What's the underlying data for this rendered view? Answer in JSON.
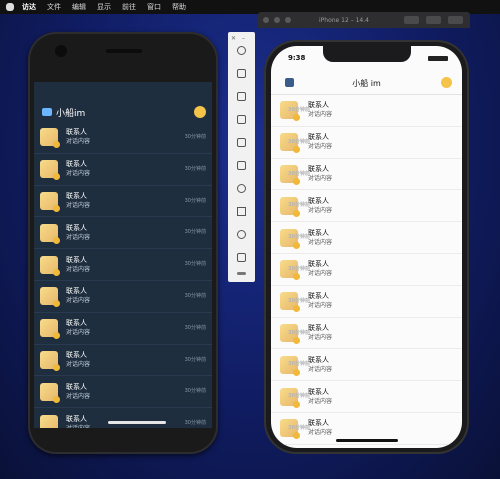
{
  "menubar": {
    "items": [
      "访达",
      "文件",
      "编辑",
      "显示",
      "前往",
      "窗口",
      "帮助"
    ]
  },
  "simulator": {
    "title": "iPhone 12 – 14.4"
  },
  "android": {
    "app_title": "小船im",
    "rows": [
      {
        "name": "联系人",
        "msg": "对话内容",
        "time": "30分钟前"
      },
      {
        "name": "联系人",
        "msg": "对话内容",
        "time": "30分钟前"
      },
      {
        "name": "联系人",
        "msg": "对话内容",
        "time": "30分钟前"
      },
      {
        "name": "联系人",
        "msg": "对话内容",
        "time": "30分钟前"
      },
      {
        "name": "联系人",
        "msg": "对话内容",
        "time": "30分钟前"
      },
      {
        "name": "联系人",
        "msg": "对话内容",
        "time": "30分钟前"
      },
      {
        "name": "联系人",
        "msg": "对话内容",
        "time": "30分钟前"
      },
      {
        "name": "联系人",
        "msg": "对话内容",
        "time": "30分钟前"
      },
      {
        "name": "联系人",
        "msg": "对话内容",
        "time": "30分钟前"
      },
      {
        "name": "联系人",
        "msg": "对话内容",
        "time": "30分钟前"
      }
    ]
  },
  "iphone": {
    "status_time": "9:38",
    "app_title": "小船 im",
    "rows": [
      {
        "name": "联系人",
        "msg": "对话内容",
        "time": "30分钟前"
      },
      {
        "name": "联系人",
        "msg": "对话内容",
        "time": "30分钟前"
      },
      {
        "name": "联系人",
        "msg": "对话内容",
        "time": "30分钟前"
      },
      {
        "name": "联系人",
        "msg": "对话内容",
        "time": "30分钟前"
      },
      {
        "name": "联系人",
        "msg": "对话内容",
        "time": "30分钟前"
      },
      {
        "name": "联系人",
        "msg": "对话内容",
        "time": "30分钟前"
      },
      {
        "name": "联系人",
        "msg": "对话内容",
        "time": "30分钟前"
      },
      {
        "name": "联系人",
        "msg": "对话内容",
        "time": "30分钟前"
      },
      {
        "name": "联系人",
        "msg": "对话内容",
        "time": "30分钟前"
      },
      {
        "name": "联系人",
        "msg": "对话内容",
        "time": "30分钟前"
      },
      {
        "name": "联系人",
        "msg": "对话内容",
        "time": "30分钟前"
      }
    ]
  }
}
